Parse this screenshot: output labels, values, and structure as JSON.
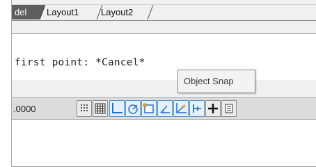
{
  "layout_tabs": {
    "model_partial": "del",
    "tabs": [
      {
        "label": "Layout1"
      },
      {
        "label": "Layout2"
      }
    ]
  },
  "command_line": {
    "text": "first point: *Cancel*"
  },
  "status_bar": {
    "coordinates": ".0000",
    "buttons": [
      {
        "icon": "infer-constraints-icon",
        "active": false
      },
      {
        "icon": "grid-display-icon",
        "active": false
      },
      {
        "icon": "ortho-mode-icon",
        "active": true
      },
      {
        "icon": "polar-tracking-icon",
        "active": true
      },
      {
        "icon": "object-snap-icon",
        "active": true
      },
      {
        "icon": "3d-object-snap-icon",
        "active": true
      },
      {
        "icon": "dynamic-ucs-icon",
        "active": true
      },
      {
        "icon": "dynamic-input-icon",
        "active": true
      },
      {
        "icon": "lineweight-icon",
        "active": false
      },
      {
        "icon": "quick-properties-icon",
        "active": false
      }
    ]
  },
  "tooltip": {
    "text": "Object Snap"
  },
  "colors": {
    "accent_blue": "#2a6fbf",
    "active_button_bg": "#e4f1fb",
    "tab_active_bg": "#5e5e5e"
  }
}
